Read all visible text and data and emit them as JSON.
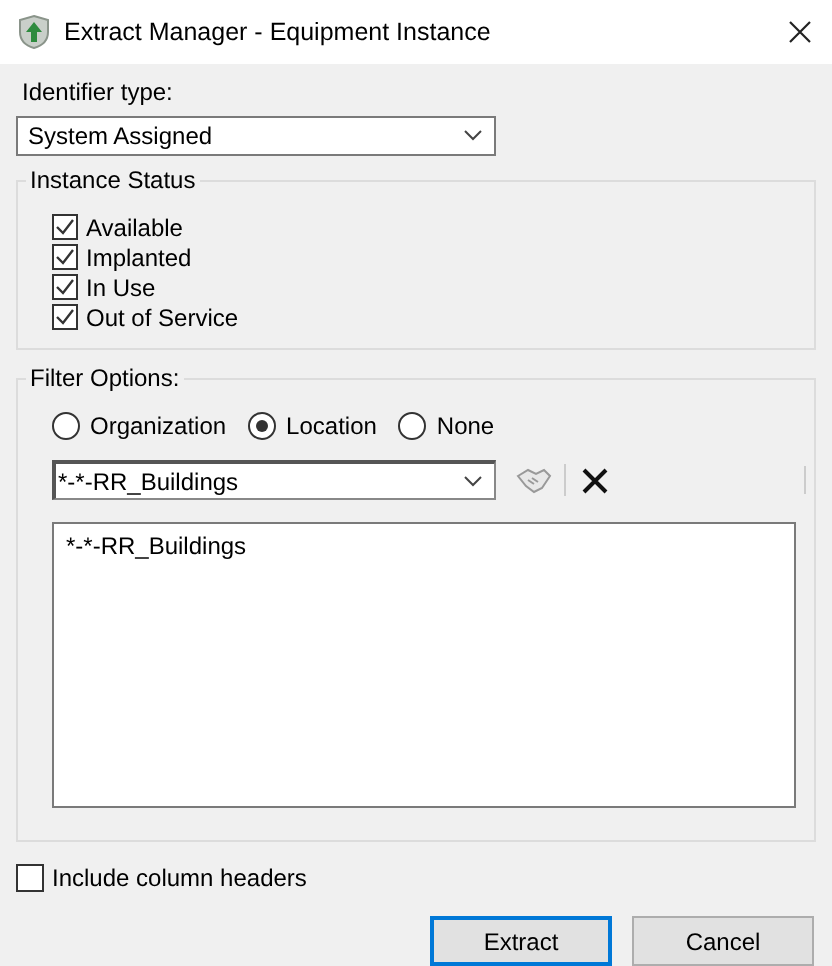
{
  "window": {
    "title": "Extract Manager - Equipment Instance"
  },
  "identifier_type": {
    "label": "Identifier type:",
    "value": "System Assigned"
  },
  "instance_status": {
    "title": "Instance Status",
    "options": [
      {
        "label": "Available",
        "checked": true
      },
      {
        "label": "Implanted",
        "checked": true
      },
      {
        "label": "In Use",
        "checked": true
      },
      {
        "label": "Out of Service",
        "checked": true
      }
    ]
  },
  "filter_options": {
    "title": "Filter Options:",
    "radios": [
      {
        "label": "Organization",
        "selected": false
      },
      {
        "label": "Location",
        "selected": true
      },
      {
        "label": "None",
        "selected": false
      }
    ],
    "filter_value": "*-*-RR_Buildings",
    "list_items": [
      "*-*-RR_Buildings"
    ]
  },
  "include_column_headers": {
    "label": "Include column headers",
    "checked": false
  },
  "buttons": [
    {
      "label": "Extract",
      "kind": "default"
    },
    {
      "label": "Cancel",
      "kind": "normal"
    }
  ]
}
